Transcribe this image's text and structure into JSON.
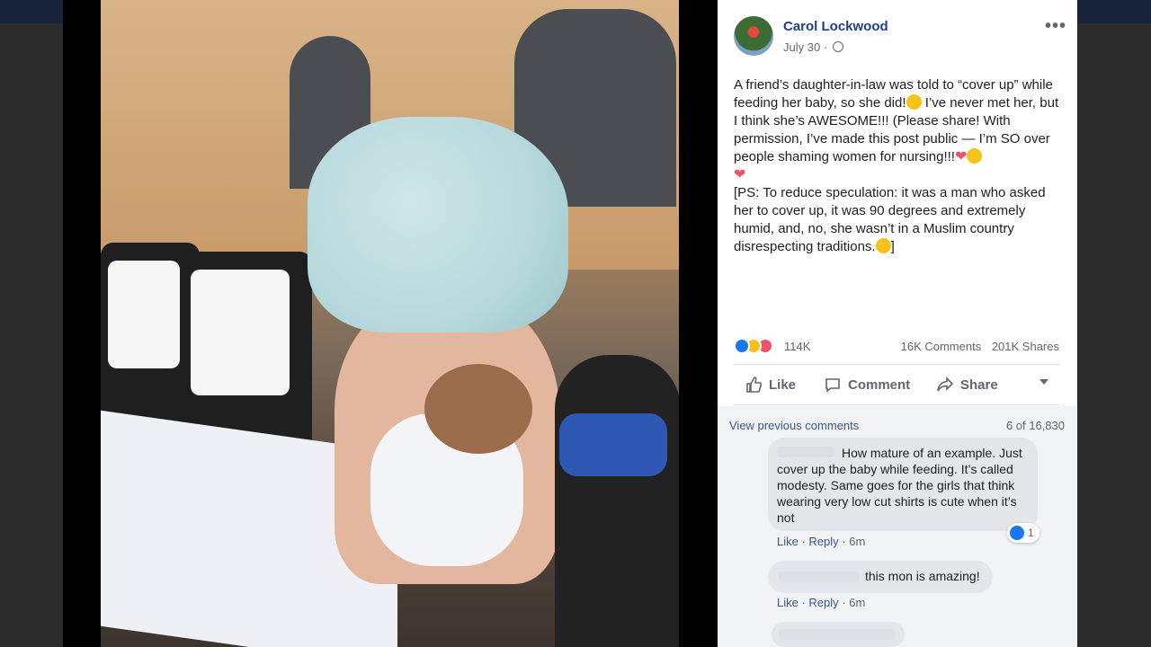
{
  "post": {
    "author": "Carol Lockwood",
    "date": "July 30",
    "separator": "·",
    "more": "•••",
    "text_p1a": "A friend’s daughter-in-law was told to “cover up” while feeding her baby, so she did!",
    "text_p1b": " I’ve never met her, but I think she’s AWESOME!!! (Please share! With permission, I’ve made this post public — I’m SO over people shaming women for nursing!!!",
    "text_p2a": "[PS: To reduce speculation: it was a man who asked her to cover up, it was 90 degrees and extremely humid, and, no, she wasn’t in a Muslim country disrespecting traditions.",
    "text_p2b": "]",
    "heart": "❤"
  },
  "reactions": {
    "count": "114K",
    "comments": "16K Comments",
    "shares": "201K Shares",
    "icons": [
      "like-icon",
      "haha-icon",
      "love-icon"
    ]
  },
  "actions": {
    "like": "Like",
    "comment": "Comment",
    "share": "Share"
  },
  "comments": {
    "view_previous": "View previous comments",
    "count": "6 of 16,830",
    "items": [
      {
        "text": "How mature of an example. Just cover up the baby while feeding. It’s called modesty. Same goes for the girls that think wearing very low cut shirts is cute when it’s not",
        "like": "Like",
        "reply": "Reply",
        "time": "6m",
        "reaction_count": "1"
      },
      {
        "text": "this mon is amazing!",
        "like": "Like",
        "reply": "Reply",
        "time": "6m"
      }
    ]
  },
  "colors": {
    "link": "#385898",
    "author": "#1d3f8f",
    "like_blue": "#1877f2",
    "love_red": "#f25268",
    "haha_yellow": "#f7c31a"
  }
}
